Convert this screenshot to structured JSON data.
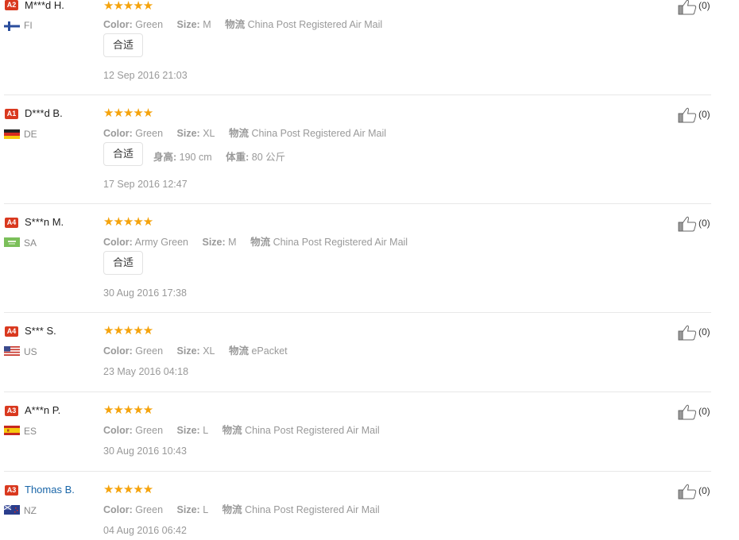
{
  "reviews": [
    {
      "level": "A2",
      "name": "M***d H.",
      "country": "FI",
      "flag": "fi",
      "stars": "★★★★★",
      "color_label": "Color:",
      "color": "Green",
      "size_label": "Size:",
      "size": "M",
      "shipping_label": "物流",
      "shipping": "China Post Registered Air Mail",
      "tag": "合适",
      "date": "12 Sep 2016 21:03",
      "likes": "(0)"
    },
    {
      "level": "A1",
      "name": "D***d B.",
      "country": "DE",
      "flag": "de",
      "stars": "★★★★★",
      "color_label": "Color:",
      "color": "Green",
      "size_label": "Size:",
      "size": "XL",
      "shipping_label": "物流",
      "shipping": "China Post Registered Air Mail",
      "tag": "合适",
      "height_label": "身高:",
      "height": "190 cm",
      "weight_label": "体重:",
      "weight": "80 公斤",
      "date": "17 Sep 2016 12:47",
      "likes": "(0)"
    },
    {
      "level": "A4",
      "name": "S***n M.",
      "country": "SA",
      "flag": "sa",
      "stars": "★★★★★",
      "color_label": "Color:",
      "color": "Army Green",
      "size_label": "Size:",
      "size": "M",
      "shipping_label": "物流",
      "shipping": "China Post Registered Air Mail",
      "tag": "合适",
      "date": "30 Aug 2016 17:38",
      "likes": "(0)"
    },
    {
      "level": "A4",
      "name": "S*** S.",
      "country": "US",
      "flag": "us",
      "stars": "★★★★★",
      "color_label": "Color:",
      "color": "Green",
      "size_label": "Size:",
      "size": "XL",
      "shipping_label": "物流",
      "shipping": "ePacket",
      "date": "23 May 2016 04:18",
      "likes": "(0)"
    },
    {
      "level": "A3",
      "name": "A***n P.",
      "country": "ES",
      "flag": "es",
      "stars": "★★★★★",
      "color_label": "Color:",
      "color": "Green",
      "size_label": "Size:",
      "size": "L",
      "shipping_label": "物流",
      "shipping": "China Post Registered Air Mail",
      "date": "30 Aug 2016 10:43",
      "likes": "(0)"
    },
    {
      "level": "A3",
      "name": "Thomas B.",
      "country": "NZ",
      "flag": "nz",
      "stars": "★★★★★",
      "color_label": "Color:",
      "color": "Green",
      "size_label": "Size:",
      "size": "L",
      "shipping_label": "物流",
      "shipping": "China Post Registered Air Mail",
      "date": "04 Aug 2016 06:42",
      "likes": "(0)"
    }
  ],
  "colors": {
    "level_badge": "#d9391f",
    "stars": "#f5a30c",
    "link_name": "#1a66a8"
  },
  "icons": {
    "like": "thumbs-up-icon"
  }
}
